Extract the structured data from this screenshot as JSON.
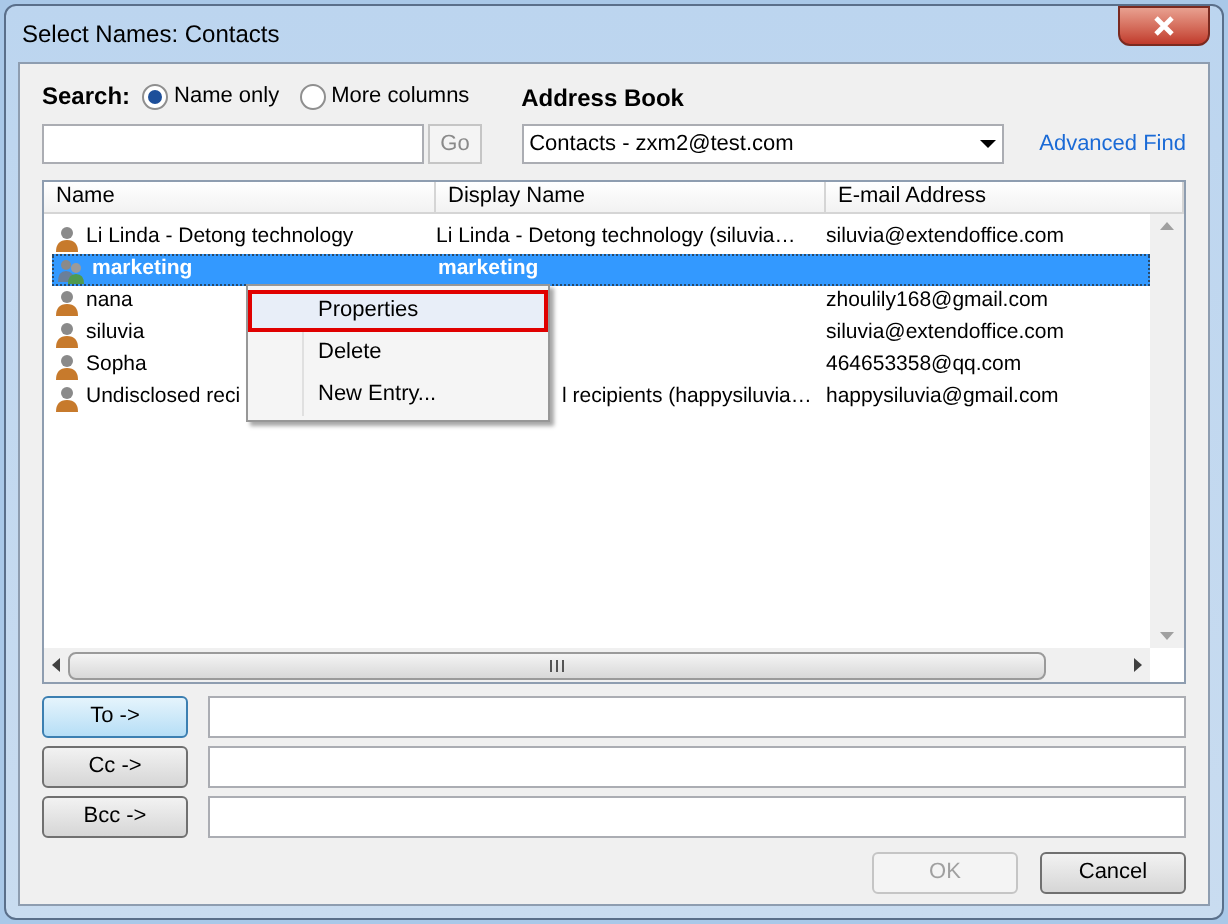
{
  "window": {
    "title": "Select Names: Contacts"
  },
  "search": {
    "label": "Search:",
    "options": [
      {
        "label": "Name only",
        "selected": true
      },
      {
        "label": "More columns",
        "selected": false
      }
    ],
    "go": "Go"
  },
  "address_book": {
    "label": "Address Book",
    "value": "Contacts - zxm2@test.com",
    "advanced_find": "Advanced Find"
  },
  "table": {
    "columns": [
      "Name",
      "Display Name",
      "E-mail Address"
    ],
    "rows": [
      {
        "kind": "contact",
        "name": "Li Linda - Detong technology",
        "display_name": "Li Linda - Detong technology (siluvia…",
        "email": "siluvia@extendoffice.com",
        "selected": false
      },
      {
        "kind": "group",
        "name": "marketing",
        "display_name": "marketing",
        "selected": true
      },
      {
        "kind": "contact",
        "name": "nana",
        "email": "zhoulily168@gmail.com",
        "selected": false
      },
      {
        "kind": "contact",
        "name": "siluvia",
        "email": "siluvia@extendoffice.com",
        "selected": false
      },
      {
        "kind": "contact",
        "name": "Sopha",
        "email": "464653358@qq.com",
        "selected": false
      },
      {
        "kind": "contact",
        "name": "Undisclosed reci",
        "display_name": "l recipients (happysiluvia…",
        "email": "happysiluvia@gmail.com",
        "selected": false
      }
    ]
  },
  "context_menu": {
    "items": [
      {
        "label": "Properties",
        "selected": true
      },
      {
        "label": "Delete",
        "selected": false
      },
      {
        "label": "New Entry...",
        "selected": false
      }
    ]
  },
  "recipients": [
    {
      "label": "To ->",
      "selected": true
    },
    {
      "label": "Cc ->",
      "selected": false
    },
    {
      "label": "Bcc ->",
      "selected": false
    }
  ],
  "buttons": [
    {
      "label": "OK",
      "disabled": true
    },
    {
      "label": "Cancel",
      "disabled": false
    }
  ]
}
